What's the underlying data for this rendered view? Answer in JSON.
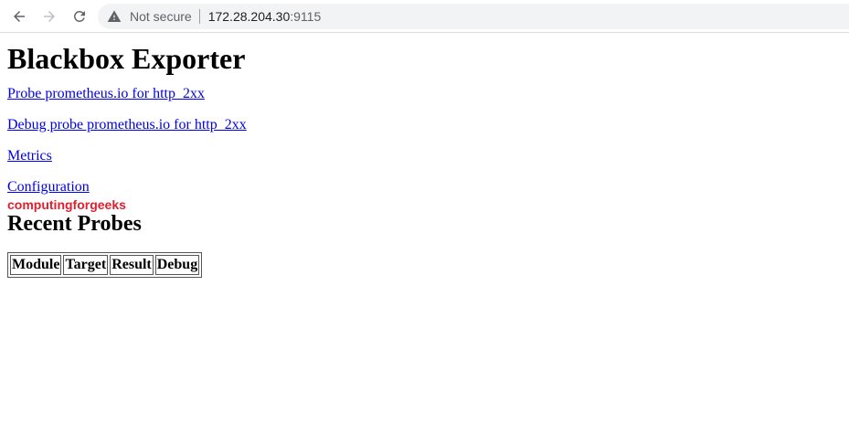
{
  "browser": {
    "security_text": "Not secure",
    "url_host": "172.28.204.30",
    "url_port": ":9115"
  },
  "page": {
    "title": "Blackbox Exporter",
    "links": [
      "Probe prometheus.io for http_2xx",
      "Debug probe prometheus.io for http_2xx",
      "Metrics",
      "Configuration"
    ],
    "watermark": "computingforgeeks",
    "recent_heading": "Recent Probes",
    "table_headers": [
      "Module",
      "Target",
      "Result",
      "Debug"
    ]
  },
  "colors": {
    "link": "#0000ee",
    "watermark": "#e0202e"
  }
}
